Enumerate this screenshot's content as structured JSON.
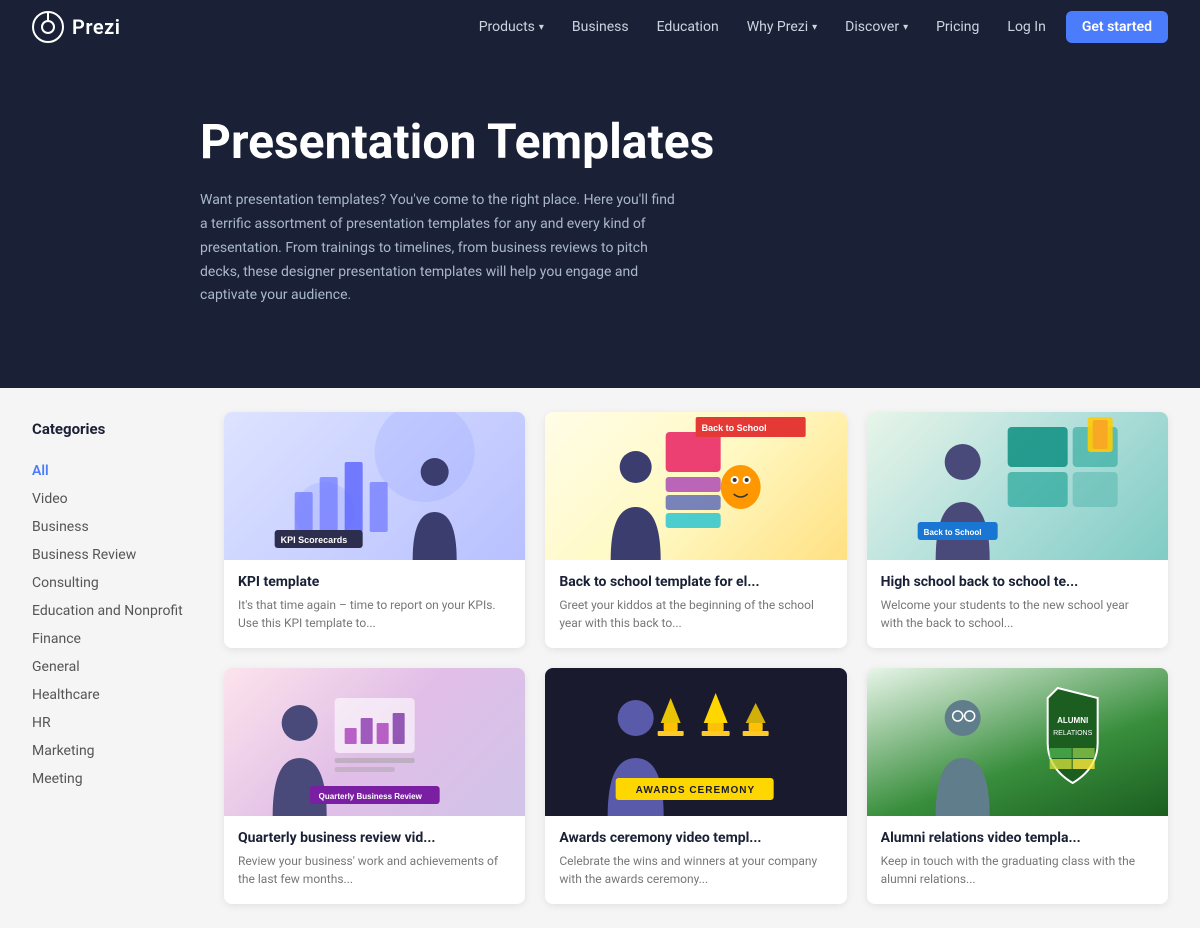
{
  "nav": {
    "logo_text": "Prezi",
    "links": [
      {
        "label": "Products",
        "has_dropdown": true
      },
      {
        "label": "Business",
        "has_dropdown": false
      },
      {
        "label": "Education",
        "has_dropdown": false
      },
      {
        "label": "Why Prezi",
        "has_dropdown": true
      },
      {
        "label": "Discover",
        "has_dropdown": true
      },
      {
        "label": "Pricing",
        "has_dropdown": false
      }
    ],
    "login_label": "Log In",
    "cta_label": "Get started"
  },
  "hero": {
    "title": "Presentation Templates",
    "description": "Want presentation templates? You've come to the right place. Here you'll find a terrific assortment of presentation templates for any and every kind of presentation. From trainings to timelines, from business reviews to pitch decks, these designer presentation templates will help you engage and captivate your audience."
  },
  "sidebar": {
    "title": "Categories",
    "items": [
      {
        "label": "All",
        "active": true
      },
      {
        "label": "Video"
      },
      {
        "label": "Business"
      },
      {
        "label": "Business Review"
      },
      {
        "label": "Consulting"
      },
      {
        "label": "Education and Nonprofit"
      },
      {
        "label": "Finance"
      },
      {
        "label": "General"
      },
      {
        "label": "Healthcare"
      },
      {
        "label": "HR"
      },
      {
        "label": "Marketing"
      },
      {
        "label": "Meeting"
      }
    ]
  },
  "templates": [
    {
      "id": "kpi",
      "title": "KPI template",
      "description": "It's that time again – time to report on your KPIs. Use this KPI template to...",
      "thumb_type": "kpi",
      "badge": "KPI  Scorecards"
    },
    {
      "id": "back-to-school",
      "title": "Back to school template for el...",
      "description": "Greet your kiddos at the beginning of the school year with this back to...",
      "thumb_type": "back-school",
      "banner": "Back to School"
    },
    {
      "id": "high-school",
      "title": "High school back to school te...",
      "description": "Welcome your students to the new school year with the back to school...",
      "thumb_type": "high-school",
      "banner": "Back to School"
    },
    {
      "id": "quarterly-review",
      "title": "Quarterly business review vid...",
      "description": "Review your business' work and achievements of the last few months...",
      "thumb_type": "business",
      "label": "Quarterly Business Review"
    },
    {
      "id": "awards",
      "title": "Awards ceremony video templ...",
      "description": "Celebrate the wins and winners at your company with the awards ceremony...",
      "thumb_type": "awards",
      "banner": "AWARDS CEREMONY"
    },
    {
      "id": "alumni",
      "title": "Alumni relations video templa...",
      "description": "Keep in touch with the graduating class with the alumni relations...",
      "thumb_type": "alumni",
      "label": "ALUMNI RELATIONS"
    }
  ]
}
